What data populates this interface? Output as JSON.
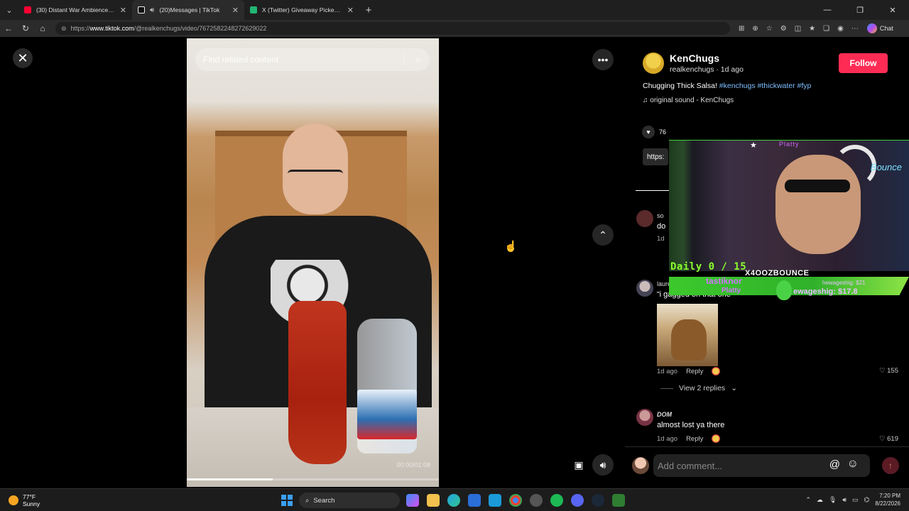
{
  "browser": {
    "tabs": [
      {
        "title": "(30) Distant War Ambience | Artill",
        "color": "#ff0033",
        "active": false
      },
      {
        "title": "(20)Messages | TikTok",
        "color": "#111111",
        "active": true
      },
      {
        "title": "X (Twitter) Giveaway Picker - Pick",
        "color": "#22b573",
        "active": false
      }
    ],
    "url_prefix": "https://",
    "url_host": "www.tiktok.com",
    "url_path": "/@realkenchugs/video/7672582248272629022",
    "chat_label": "Chat"
  },
  "video": {
    "search_placeholder": "Find related content",
    "time_label": "00:00/01:08",
    "progress": 0.34
  },
  "author": {
    "display_name": "KenChugs",
    "meta": "realkenchugs · 1d ago",
    "follow_label": "Follow",
    "caption_text": "Chugging Thick Salsa! ",
    "hashtags": [
      "#kenchugs",
      "#thickwater",
      "#fyp"
    ],
    "sound": "original sound - KenChugs",
    "likes_partial": "76",
    "link_partial": "https:"
  },
  "stream_overlay": {
    "top_name": "Platty",
    "daily": "Daily 0 / 15",
    "handle": "X4OOZBOUNCE",
    "name1": "tastiknor",
    "name2": "Platty",
    "sub1": "hewageshig: $21",
    "sub2": "ewageshig: $17.8",
    "brand": "Bounce"
  },
  "comments": [
    {
      "name": "so",
      "text": "do",
      "meta": "1d"
    },
    {
      "name": "lauren",
      "text": "“i gagged on that one”",
      "meta": "1d ago",
      "reply": "Reply",
      "likes": "155",
      "view_replies": "View 2 replies"
    },
    {
      "name": "DOM",
      "text": "almost lost ya there",
      "meta": "1d ago",
      "reply": "Reply",
      "likes": "619"
    }
  ],
  "comment_bar": {
    "placeholder": "Add comment...",
    "at": "@"
  },
  "taskbar": {
    "temp": "77°F",
    "condition": "Sunny",
    "search_label": "Search",
    "time": "7:20 PM",
    "date": "8/22/2026"
  }
}
